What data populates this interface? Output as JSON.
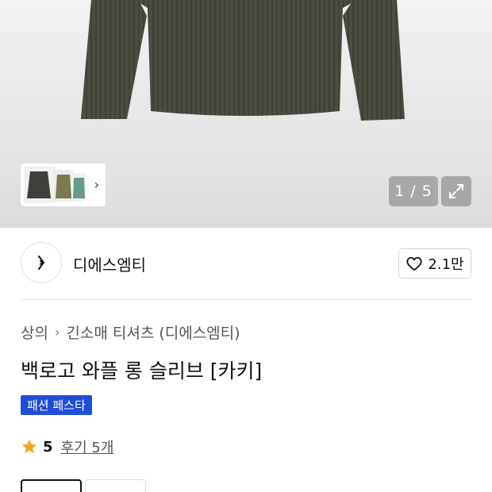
{
  "gallery": {
    "counter": "1 / 5"
  },
  "brand": {
    "name": "디에스엠티",
    "likes": "2.1만"
  },
  "breadcrumb": {
    "category": "상의",
    "subcategory": "긴소매 티셔츠 (디에스엠티)"
  },
  "product": {
    "title": "백로고 와플 롱 슬리브 [카키]",
    "badge": "패션 페스타"
  },
  "rating": {
    "score": "5",
    "reviews": "후기 5개"
  },
  "colors": {
    "badge_bg": "#1f4ed8",
    "star": "#f5a623",
    "shirt": "#4b4e42"
  }
}
